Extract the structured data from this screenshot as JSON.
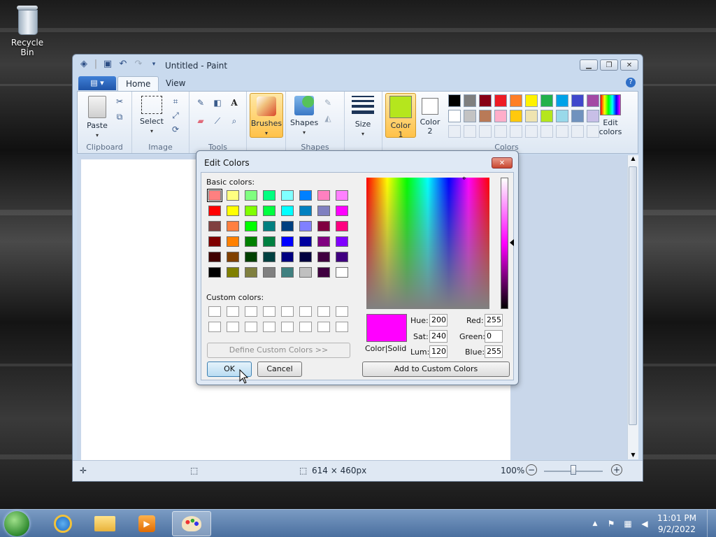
{
  "desktop": {
    "recycle_bin_label": "Recycle Bin"
  },
  "window": {
    "title": "Untitled - Paint",
    "tabs": {
      "home": "Home",
      "view": "View"
    },
    "help": "?"
  },
  "ribbon": {
    "clipboard": {
      "label": "Clipboard",
      "paste": "Paste"
    },
    "image": {
      "label": "Image",
      "select": "Select"
    },
    "tools": {
      "label": "Tools"
    },
    "brushes": {
      "label": "Brushes"
    },
    "shapes": {
      "label": "Shapes",
      "button": "Shapes"
    },
    "size": {
      "label": "Size"
    },
    "colors": {
      "label": "Colors",
      "color1_label": "Color\n1",
      "color2_label": "Color\n2",
      "edit_colors": "Edit\ncolors",
      "color1": "#b5e61d",
      "color2": "#ffffff",
      "row1": [
        "#000000",
        "#7f7f7f",
        "#880015",
        "#ed1c24",
        "#ff7f27",
        "#fff200",
        "#22b14c",
        "#00a2e8",
        "#3f48cc",
        "#a349a4"
      ],
      "row2": [
        "#ffffff",
        "#c3c3c3",
        "#b97a57",
        "#ffaec9",
        "#ffc90e",
        "#efe4b0",
        "#b5e61d",
        "#99d9ea",
        "#7092be",
        "#c8bfe7"
      ]
    }
  },
  "statusbar": {
    "canvas_size": "614 × 460px",
    "zoom": "100%"
  },
  "dialog": {
    "title": "Edit Colors",
    "basic_colors_label": "Basic colors:",
    "custom_colors_label": "Custom colors:",
    "define_custom": "Define Custom Colors >>",
    "ok": "OK",
    "cancel": "Cancel",
    "add_custom": "Add to Custom Colors",
    "color_solid": "Color|Solid",
    "hue_label": "Hue:",
    "hue": "200",
    "sat_label": "Sat:",
    "sat": "240",
    "lum_label": "Lum:",
    "lum": "120",
    "red_label": "Red:",
    "red": "255",
    "green_label": "Green:",
    "green": "0",
    "blue_label": "Blue:",
    "blue": "255",
    "preview_color": "#ff00ff",
    "basic_colors": [
      [
        "#ff8080",
        "#ffff80",
        "#80ff80",
        "#00ff80",
        "#80ffff",
        "#0080ff",
        "#ff80c0",
        "#ff80ff"
      ],
      [
        "#ff0000",
        "#ffff00",
        "#80ff00",
        "#00ff40",
        "#00ffff",
        "#0080c0",
        "#8080c0",
        "#ff00ff"
      ],
      [
        "#804040",
        "#ff8040",
        "#00ff00",
        "#008080",
        "#004080",
        "#8080ff",
        "#800040",
        "#ff0080"
      ],
      [
        "#800000",
        "#ff8000",
        "#008000",
        "#008040",
        "#0000ff",
        "#0000a0",
        "#800080",
        "#8000ff"
      ],
      [
        "#400000",
        "#804000",
        "#004000",
        "#004040",
        "#000080",
        "#000040",
        "#400040",
        "#400080"
      ],
      [
        "#000000",
        "#808000",
        "#808040",
        "#808080",
        "#408080",
        "#c0c0c0",
        "#400040",
        "#ffffff"
      ]
    ]
  },
  "taskbar": {
    "time": "11:01 PM",
    "date": "9/2/2022"
  }
}
